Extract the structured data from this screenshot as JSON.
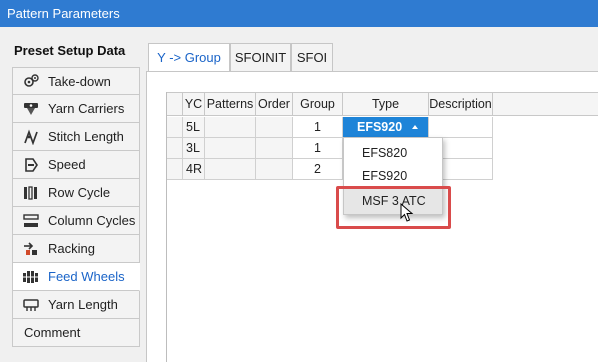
{
  "window": {
    "title": "Pattern Parameters"
  },
  "left_panel": {
    "heading": "Preset Setup Data",
    "items": [
      {
        "label": "Take-down",
        "icon": "take-down-icon"
      },
      {
        "label": "Yarn Carriers",
        "icon": "yarn-carriers-icon"
      },
      {
        "label": "Stitch Length",
        "icon": "stitch-length-icon"
      },
      {
        "label": "Speed",
        "icon": "speed-icon"
      },
      {
        "label": "Row Cycle",
        "icon": "row-cycle-icon"
      },
      {
        "label": "Column Cycles",
        "icon": "column-cycles-icon"
      },
      {
        "label": "Racking",
        "icon": "racking-icon"
      },
      {
        "label": "Feed Wheels",
        "icon": "feed-wheels-icon",
        "selected": true
      },
      {
        "label": "Yarn Length",
        "icon": "yarn-length-icon"
      },
      {
        "label": "Comment",
        "icon": ""
      }
    ]
  },
  "tabs": [
    {
      "label": "Y -> Group",
      "active": true
    },
    {
      "label": "SFOINIT"
    },
    {
      "label": "SFOI"
    }
  ],
  "grid": {
    "columns": [
      "YC",
      "Patterns",
      "Order",
      "Group",
      "Type",
      "Description"
    ],
    "rows": [
      {
        "yc": "5L",
        "group": "1",
        "type": "EFS920"
      },
      {
        "yc": "3L",
        "group": "1",
        "type": ""
      },
      {
        "yc": "4R",
        "group": "2",
        "type": ""
      }
    ]
  },
  "dropdown": {
    "options": [
      "EFS820",
      "EFS920",
      "MSF 3 ATC"
    ],
    "hovered_index": 2
  },
  "colors": {
    "titlebar": "#2f7bd1",
    "selected_cell": "#1e84d8",
    "highlight": "#d94b4b",
    "selected_text": "#1a64c8"
  }
}
